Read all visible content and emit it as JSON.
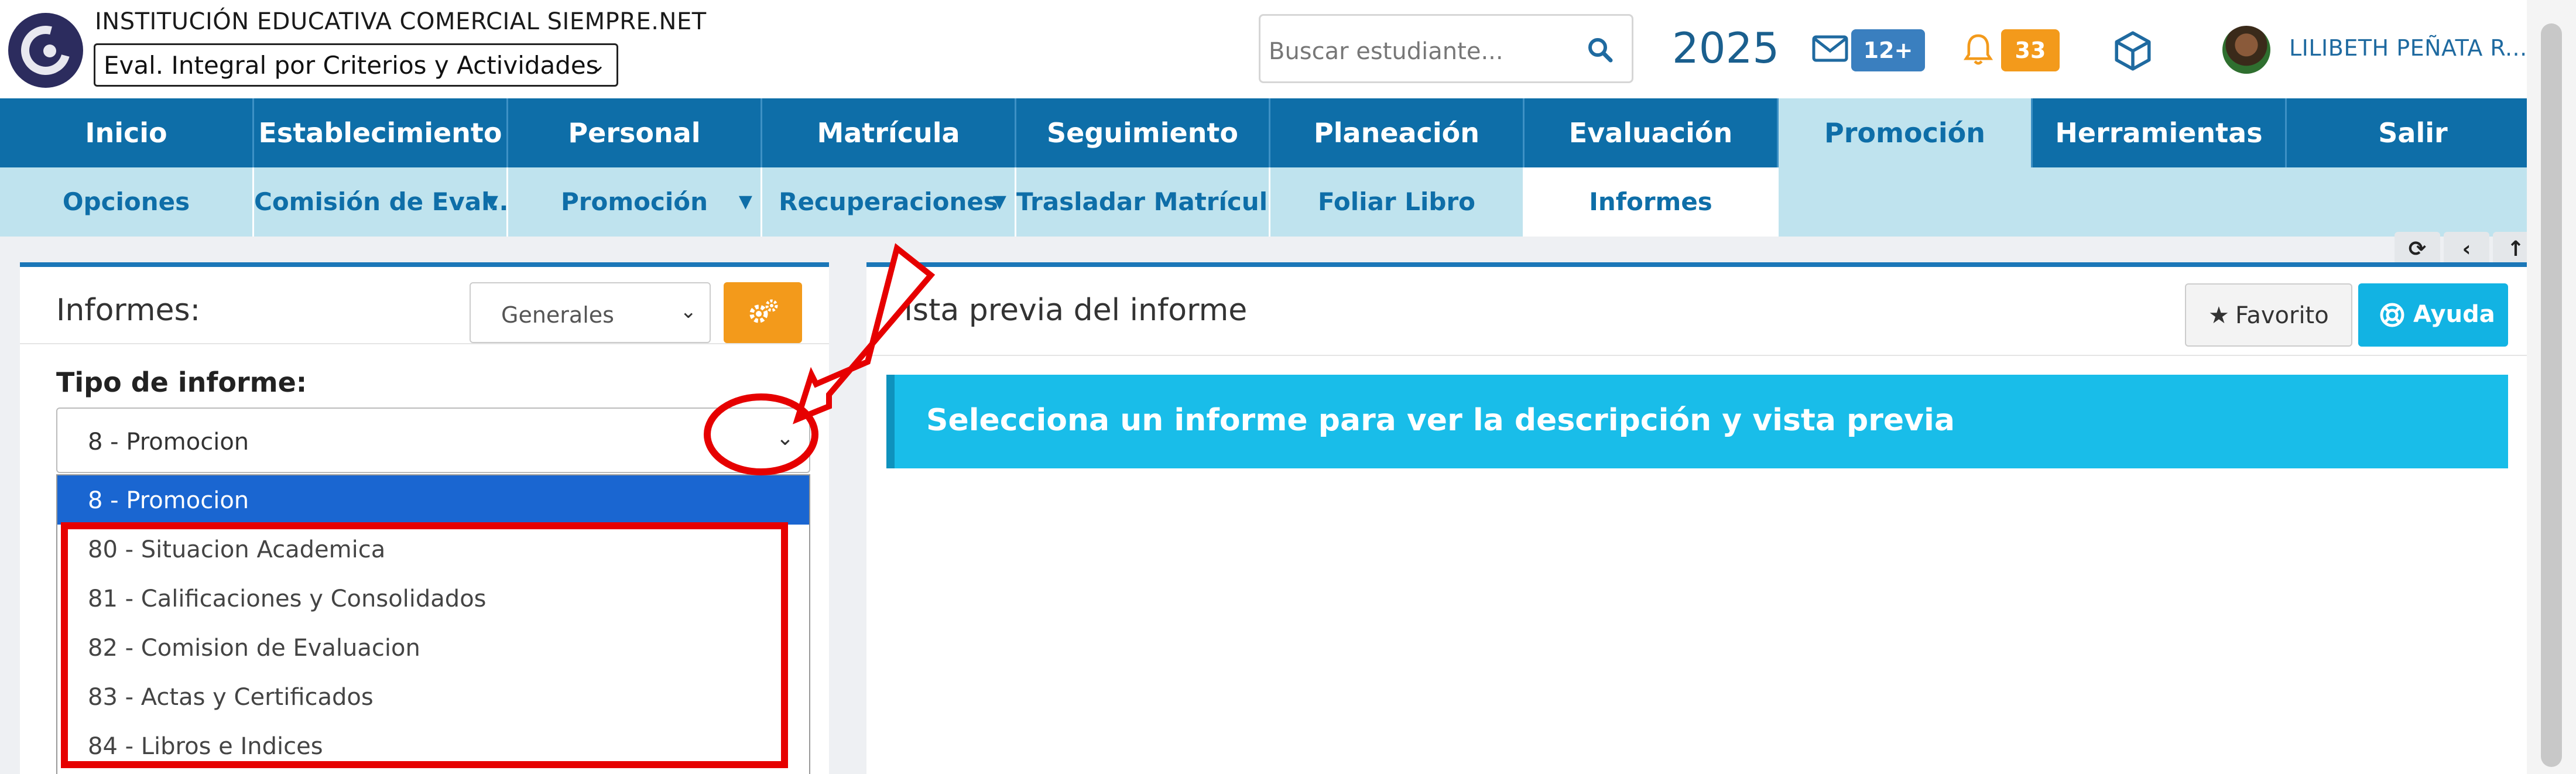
{
  "header": {
    "school_name": "INSTITUCIÓN EDUCATIVA COMERCIAL SIEMPRE.NET",
    "eval_mode": "Eval. Integral por Criterios y Actividades",
    "search_placeholder": "Buscar estudiante...",
    "year": "2025",
    "messages_badge": "12+",
    "notifications_badge": "33",
    "user_name": "LILIBETH PEÑATA R..."
  },
  "nav": {
    "items": [
      "Inicio",
      "Establecimiento",
      "Personal",
      "Matrícula",
      "Seguimiento",
      "Planeación",
      "Evaluación",
      "Promoción",
      "Herramientas",
      "Salir"
    ],
    "active": "Promoción"
  },
  "subnav": {
    "items": [
      "Opciones",
      "Comisión de Eval...",
      "Promoción",
      "Recuperaciones",
      "Trasladar Matrícula",
      "Foliar Libro",
      "Informes"
    ],
    "arrow": "▼",
    "active": "Informes"
  },
  "toolbar_icons": [
    "refresh-icon",
    "back-icon",
    "up-icon"
  ],
  "left_panel": {
    "title": "Informes:",
    "filter_value": "Generales",
    "tipo_label": "Tipo de informe:",
    "tipo_value": "8 - Promocion",
    "options": [
      "8 - Promocion",
      "80 - Situacion Academica",
      "81 - Calificaciones y Consolidados",
      "82 - Comision de Evaluacion",
      "83 - Actas y Certificados",
      "84 - Libros e Indices"
    ]
  },
  "right_panel": {
    "title": "Vista previa del informe",
    "favorite_label": "Favorito",
    "help_label": "Ayuda",
    "info_message": "Selecciona un informe para ver la descripción y vista previa"
  },
  "colors": {
    "nav_bg": "#0e6ea8",
    "subnav_bg": "#bfe3ee",
    "accent_orange": "#f39a1b",
    "info_blue": "#19bde9",
    "selected_option": "#1a66d1",
    "annotation_red": "#e60000"
  }
}
